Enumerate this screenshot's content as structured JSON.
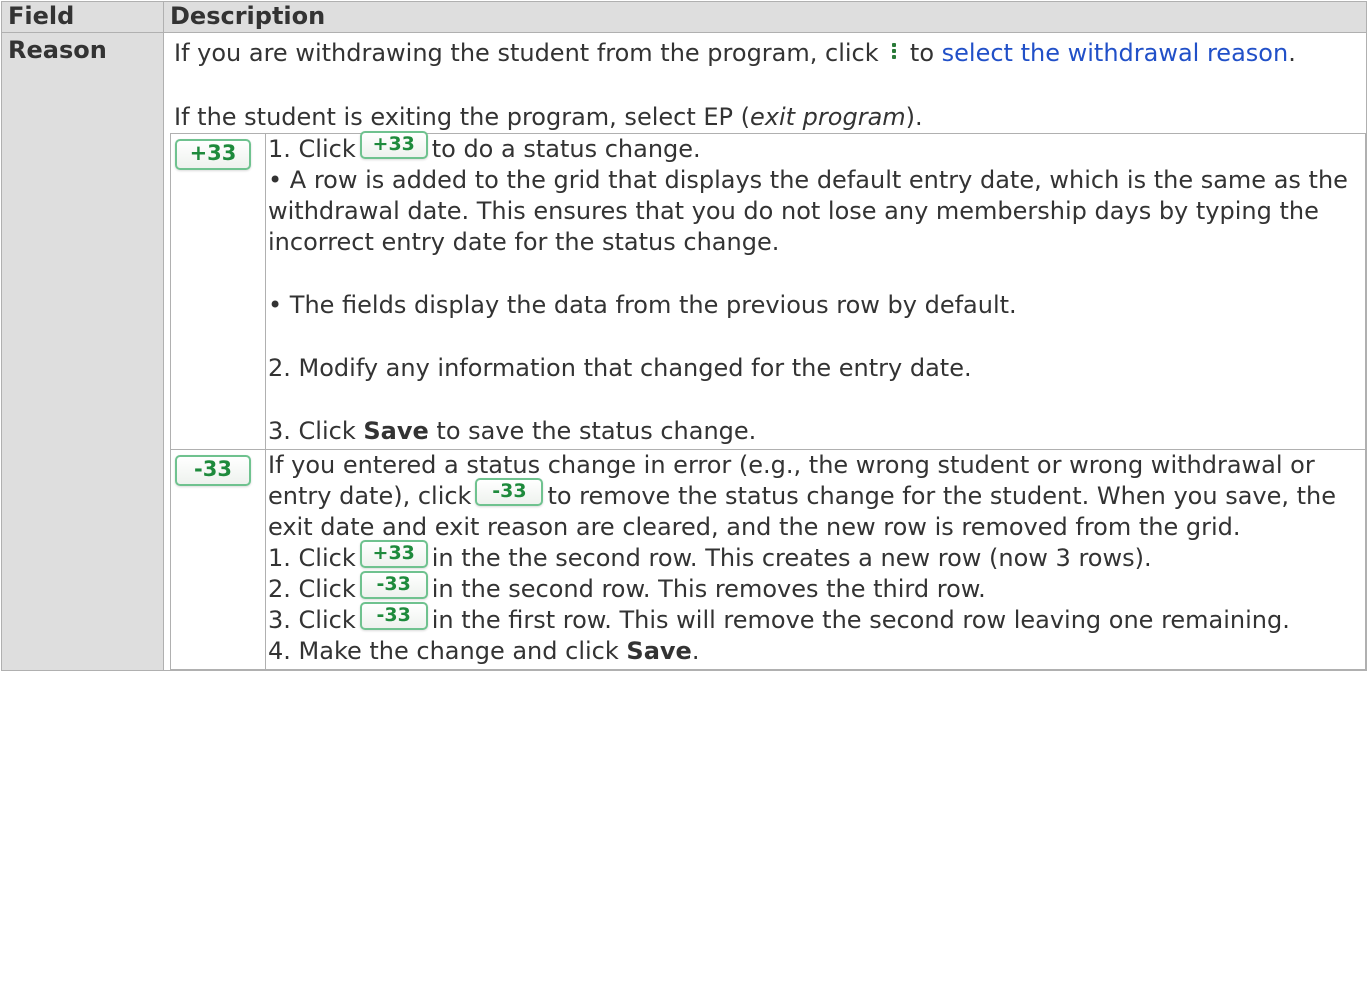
{
  "header": {
    "field": "Field",
    "description": "Description"
  },
  "row": {
    "field": "Reason",
    "intro_before_icon": "If you are withdrawing the student from the program, click",
    "intro_after_icon": "to",
    "intro_link": "select the withdrawal reason",
    "intro_end": ".",
    "exit_before": "If the student is exiting the program, select EP (",
    "exit_italic": "exit program",
    "exit_after": ")."
  },
  "plus_row": {
    "button": "+33",
    "step1_prefix": "1. Click",
    "step1_suffix": "to do a status change.",
    "bullet1": "• A row is added to the grid that displays the default entry date, which is the same as the withdrawal date. This ensures that you do not lose any membership days by typing the incorrect entry date for the status change.",
    "bullet2": "• The fields display the data from the previous row by default.",
    "step2": "2. Modify any information that changed for the entry date.",
    "step3_prefix": "3. Click",
    "step3_bold": "Save",
    "step3_suffix": "to save the status change."
  },
  "minus_row": {
    "button": "-33",
    "intro_prefix": "If you entered a status change in error (e.g., the wrong student or wrong withdrawal or entry date), click",
    "intro_suffix": "to remove the status change for the student. When you save, the exit date and exit reason are cleared, and the new row is removed from the grid.",
    "s1_prefix": "1. Click",
    "s1_button": "+33",
    "s1_suffix": "in the the second row. This creates a new row (now 3 rows).",
    "s2_prefix": "2. Click",
    "s2_button": "-33",
    "s2_suffix": "in the second row. This removes the third row.",
    "s3_prefix": "3. Click",
    "s3_button": "-33",
    "s3_suffix": "in the first row. This will remove the second row leaving one remaining.",
    "s4_prefix": "4. Make the change and click",
    "s4_bold": "Save",
    "s4_suffix": "."
  },
  "icons": {
    "kebab": "vertical-dots-icon"
  },
  "colors": {
    "header_bg": "#dedede",
    "link": "#2150c8",
    "button_text": "#1e8a3c",
    "button_border": "#6fc28f"
  }
}
